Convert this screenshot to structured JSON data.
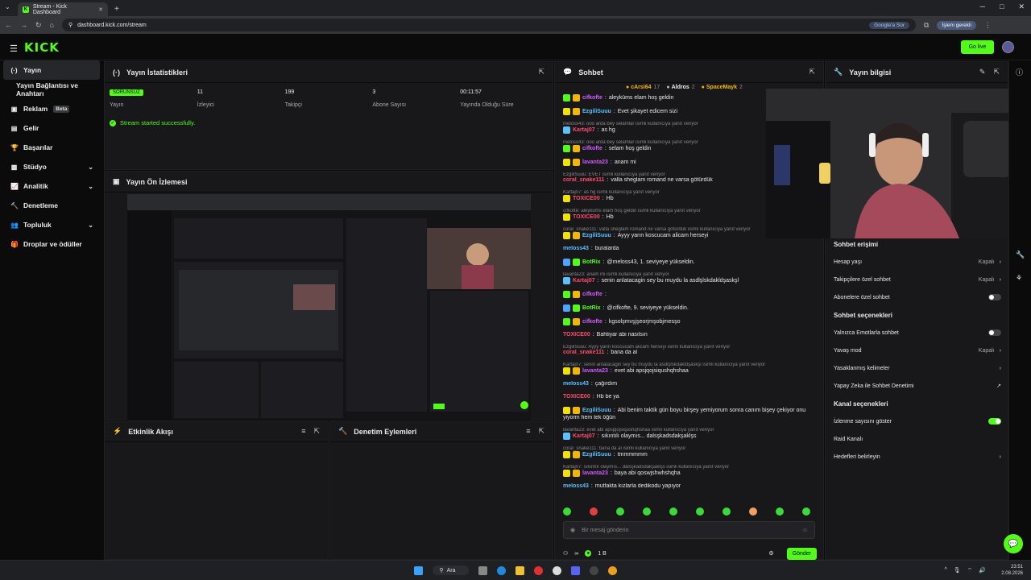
{
  "browser": {
    "tab_title": "Stream - Kick Dashboard",
    "tab_favicon": "K",
    "close_glyph": "✕",
    "newtab_glyph": "+",
    "url": "dashboard.kick.com/stream",
    "google_pill": "Google'a Sor",
    "profile_label": "İşlem gerekli",
    "nav_icons": [
      "back-icon",
      "forward-icon",
      "reload-icon",
      "home-icon"
    ]
  },
  "header": {
    "logo": "KICK",
    "go_live_label": "Go live"
  },
  "sidebar": {
    "items": [
      {
        "label": "Yayın",
        "icon": "(·)",
        "active": true
      },
      {
        "label": "Yayın Bağlantısı ve Anahtarı",
        "icon": "",
        "sub": true
      },
      {
        "label": "Reklam",
        "icon": "▣",
        "badge": "Beta"
      },
      {
        "label": "Gelir",
        "icon": "▤"
      },
      {
        "label": "Başarılar",
        "icon": "🏆"
      },
      {
        "label": "Stüdyo",
        "icon": "▩",
        "chevron": "⌄"
      },
      {
        "label": "Analitik",
        "icon": "📈",
        "chevron": "⌄"
      },
      {
        "label": "Denetleme",
        "icon": "🔨"
      },
      {
        "label": "Topluluk",
        "icon": "👥",
        "chevron": "⌄"
      },
      {
        "label": "Droplar ve ödüller",
        "icon": "🎁"
      }
    ]
  },
  "stats": {
    "title": "Yayın İstatistikleri",
    "items": [
      {
        "value": "SORUNSUZ",
        "label": "Yayın",
        "badge": true
      },
      {
        "value": "11",
        "label": "İzleyici"
      },
      {
        "value": "199",
        "label": "Takipçi"
      },
      {
        "value": "3",
        "label": "Abone Sayısı"
      },
      {
        "value": "00:11:57",
        "label": "Yayında Olduğu Süre"
      }
    ],
    "status_message": "Stream started successfully."
  },
  "preview": {
    "title": "Yayın Ön İzlemesi"
  },
  "activity": {
    "title": "Etkinlik Akışı"
  },
  "moderation": {
    "title": "Denetim Eylemleri"
  },
  "chat": {
    "title": "Sohbet",
    "pinned": [
      {
        "name": "cArsi64",
        "count": "17"
      },
      {
        "name": "Aldros",
        "count": "2"
      },
      {
        "name": "SpaceMayk",
        "count": "2"
      }
    ],
    "messages": [
      {
        "user": "cifkofte",
        "color": "#d05cff",
        "text": "aleyküms elam hoş geldin",
        "badges": [
          "#53fc18",
          "#f2b705"
        ]
      },
      {
        "user": "EzgiliSuuu",
        "color": "#5cc0ff",
        "text": "Evet şikayet edicem sizi",
        "badges": [
          "#f2e105",
          "#f2b705"
        ]
      },
      {
        "reply": "meloss43: ooo arda bey selamlar isimli kullanıcıya yanıt veriyor"
      },
      {
        "user": "Kartaj07",
        "color": "#ff4d6a",
        "text": "as hg",
        "badges": [
          "#5cc0ff"
        ]
      },
      {
        "reply": "meloss43: ooo arda bey selamlar isimli kullanıcıya yanıt veriyor"
      },
      {
        "user": "cifkofte",
        "color": "#d05cff",
        "text": "selam hoş geldin",
        "badges": [
          "#53fc18",
          "#f2b705"
        ]
      },
      {
        "user": "lavanta23",
        "color": "#d05cff",
        "text": "anam mi",
        "badges": [
          "#f2e105",
          "#f2b705"
        ]
      },
      {
        "reply": "EzgiliSuuu: EVET isimli kullanıcıya yanıt veriyor"
      },
      {
        "user": "coral_snake111",
        "color": "#ff4d6a",
        "text": "valla sheglam romand ne varsa götürdük",
        "badges": []
      },
      {
        "reply": "Kartaj07: as hg isimli kullanıcıya yanıt veriyor"
      },
      {
        "user": "TOXICE00",
        "color": "#ff4d6a",
        "text": "Hb",
        "badges": [
          "#f2e105"
        ]
      },
      {
        "reply": "cifkofte: aleyküms elam hoş geldin isimli kullanıcıya yanıt veriyor"
      },
      {
        "user": "TOXICE00",
        "color": "#ff4d6a",
        "text": "Hb",
        "badges": [
          "#f2e105"
        ]
      },
      {
        "reply": "coral_snake111: valla sheglam romand ne varsa götürdük isimli kullanıcıya yanıt veriyor"
      },
      {
        "user": "EzgiliSuuu",
        "color": "#5cc0ff",
        "text": "Ayyy yarın koscucam alicam herseyi",
        "badges": [
          "#f2e105",
          "#f2b705"
        ]
      },
      {
        "user": "meloss43",
        "color": "#5cc0ff",
        "text": "buralarda",
        "badges": []
      },
      {
        "user": "BotRix",
        "color": "#53fc18",
        "text": "@meloss43, 1. seviyeye yükseldin.",
        "badges": [
          "#4da3ff",
          "#53fc18"
        ]
      },
      {
        "reply": "lavanta23: anam mi isimli kullanıcıya yanıt veriyor"
      },
      {
        "user": "Kartaj07",
        "color": "#ff4d6a",
        "text": "senin anlatacagin sey bu muydu la asdlşlskdakldşaskşl",
        "badges": [
          "#5cc0ff"
        ]
      },
      {
        "user": "cifkofte",
        "color": "#d05cff",
        "text": "",
        "badges": [
          "#53fc18",
          "#f2b705"
        ]
      },
      {
        "user": "BotRix",
        "color": "#53fc18",
        "text": "@cifkofte, 9. seviyeye yükseldin.",
        "badges": [
          "#4da3ff",
          "#53fc18"
        ]
      },
      {
        "user": "cifkofte",
        "color": "#d05cff",
        "text": "kgsolşmvşjşeorjmşobjmesşo",
        "badges": [
          "#53fc18",
          "#f2b705"
        ]
      },
      {
        "user": "TOXICE00",
        "color": "#ff4d6a",
        "text": "Bahtiyar abi nasılsın",
        "badges": []
      },
      {
        "reply": "EzgiliSuuu: Ayyy yarın koscucam alicam herseyi isimli kullanıcıya yanıt veriyor"
      },
      {
        "user": "coral_snake111",
        "color": "#ff4d6a",
        "text": "bana da al",
        "badges": []
      },
      {
        "reply": "Kartaj07: senin anlatacagin sey bu muydu la asdlşlskdakldşaskşl isimli kullanıcıya yanıt veriyor"
      },
      {
        "user": "lavanta23",
        "color": "#d05cff",
        "text": "evet abi apsjqojsiqushqhshaa",
        "badges": [
          "#f2e105",
          "#f2b705"
        ]
      },
      {
        "user": "meloss43",
        "color": "#5cc0ff",
        "text": "çağırdım",
        "badges": []
      },
      {
        "user": "TOXICE00",
        "color": "#ff4d6a",
        "text": "Hb be ya",
        "badges": []
      },
      {
        "user": "EzgiliSuuu",
        "color": "#5cc0ff",
        "text": "Abi benim taktik gün boyu birşey yemiyorum sonra canım bişey çekiyor onu",
        "badges": [
          "#f2e105",
          "#f2b705"
        ]
      },
      {
        "cont": "yiyorm hem tek öğün"
      },
      {
        "reply": "lavanta23: evet abi apsjqojsiqushqhshaa isimli kullanıcıya yanıt veriyor"
      },
      {
        "user": "Kartaj07",
        "color": "#ff4d6a",
        "text": "sıkıntılı olaymıs... dalsşkadsdakşaklşs",
        "badges": [
          "#5cc0ff"
        ]
      },
      {
        "reply": "coral_snake111: bana da al isimli kullanıcıya yanıt veriyor"
      },
      {
        "user": "EzgiliSuuu",
        "color": "#5cc0ff",
        "text": "tmmmmmm",
        "badges": [
          "#f2e105",
          "#f2b705"
        ]
      },
      {
        "reply": "Kartaj07: sıkıntılı olaymıs... dalsşkadsdakşaklşs isimli kullanıcıya yanıt veriyor"
      },
      {
        "user": "lavanta23",
        "color": "#d05cff",
        "text": "baya abi qoswjshwhshqha",
        "badges": [
          "#f2e105",
          "#f2b705"
        ]
      },
      {
        "user": "meloss43",
        "color": "#5cc0ff",
        "text": "mutfakta kızlarla dedikodu yapıyor",
        "badges": []
      }
    ],
    "input_placeholder": "Bir mesaj gönderin",
    "infinity_label": "∞",
    "points": "1 B",
    "send_label": "Gönder"
  },
  "stream_info": {
    "title": "Yayın bilgisi",
    "chat_access_title": "Sohbet erişimi",
    "chat_access": [
      {
        "label": "Hesap yaşı",
        "value": "Kapalı",
        "chevron": "›"
      },
      {
        "label": "Takipçilere özel sohbet",
        "value": "Kapalı",
        "chevron": "›"
      },
      {
        "label": "Abonelere özel sohbet",
        "toggle": false
      }
    ],
    "chat_options_title": "Sohbet seçenekleri",
    "chat_options": [
      {
        "label": "Yalnızca Emotlarla sohbet",
        "toggle": false
      },
      {
        "label": "Yavaş mod",
        "value": "Kapalı",
        "chevron": "›"
      },
      {
        "label": "Yasaklanmış kelimeler",
        "chevron": "›"
      },
      {
        "label": "Yapay Zeka ile Sohbet Denetimi",
        "chevron": "↗"
      }
    ],
    "channel_options_title": "Kanal seçenekleri",
    "channel_options": [
      {
        "label": "İzlenme sayısını göster",
        "toggle": true
      },
      {
        "label": "Raid Kanalı"
      },
      {
        "label": "Hedefleri belirleyin",
        "chevron": "›"
      }
    ]
  },
  "taskbar": {
    "search_label": "Ara",
    "time": "23:51",
    "date": "2.08.2026"
  },
  "colors": {
    "accent": "#53fc18",
    "panel": "#18181b",
    "bg": "#0b0b0c"
  }
}
